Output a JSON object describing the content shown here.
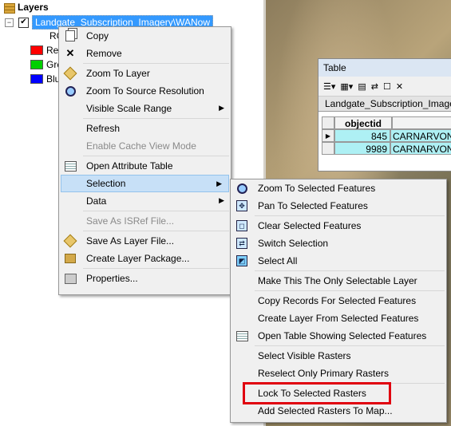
{
  "toc": {
    "header": "Layers",
    "layer_name": "Landgate_Subscription_Imagery\\WANow",
    "band_label_prefix": "RG",
    "bands": [
      {
        "label": "Red",
        "color": "#ff0000"
      },
      {
        "label": "Green",
        "color": "#00d000"
      },
      {
        "label": "Blue",
        "color": "#0000ff"
      }
    ]
  },
  "table": {
    "title": "Table",
    "tab": "Landgate_Subscription_Imagery",
    "column": "objectid",
    "rows": [
      {
        "id": "845",
        "name": "CARNARVON_"
      },
      {
        "id": "9989",
        "name": "CARNARVON_"
      }
    ]
  },
  "context_menu": {
    "items": [
      {
        "label": "Copy",
        "icon": "copy-icon"
      },
      {
        "label": "Remove",
        "icon": "remove-icon"
      },
      {
        "label": "Zoom To Layer",
        "icon": "zoom-layer-icon"
      },
      {
        "label": "Zoom To Source Resolution",
        "icon": "zoom-source-icon"
      },
      {
        "label": "Visible Scale Range"
      },
      {
        "label": "Refresh"
      },
      {
        "label": "Enable Cache View Mode"
      },
      {
        "label": "Open Attribute Table",
        "icon": "table-icon"
      },
      {
        "label": "Selection"
      },
      {
        "label": "Data"
      },
      {
        "label": "Save As ISRef File..."
      },
      {
        "label": "Save As Layer File...",
        "icon": "layer-file-icon"
      },
      {
        "label": "Create Layer Package...",
        "icon": "package-icon"
      },
      {
        "label": "Properties...",
        "icon": "properties-icon"
      }
    ]
  },
  "selection_menu": {
    "items": [
      {
        "label": "Zoom To Selected Features",
        "icon": "zoom-selected-icon"
      },
      {
        "label": "Pan To Selected Features",
        "icon": "pan-selected-icon"
      },
      {
        "label": "Clear Selected Features",
        "icon": "clear-selection-icon"
      },
      {
        "label": "Switch Selection",
        "icon": "switch-selection-icon"
      },
      {
        "label": "Select All",
        "icon": "select-all-icon"
      },
      {
        "label": "Make This The Only Selectable Layer"
      },
      {
        "label": "Copy Records For Selected Features"
      },
      {
        "label": "Create Layer From Selected Features"
      },
      {
        "label": "Open Table Showing Selected Features",
        "icon": "table-icon"
      },
      {
        "label": "Select Visible Rasters"
      },
      {
        "label": "Reselect Only Primary Rasters"
      },
      {
        "label": "Lock To Selected Rasters"
      },
      {
        "label": "Add Selected Rasters To Map..."
      }
    ]
  },
  "colors": {
    "selection_highlight": "#c7e0f7",
    "callout": "#e0000f"
  }
}
